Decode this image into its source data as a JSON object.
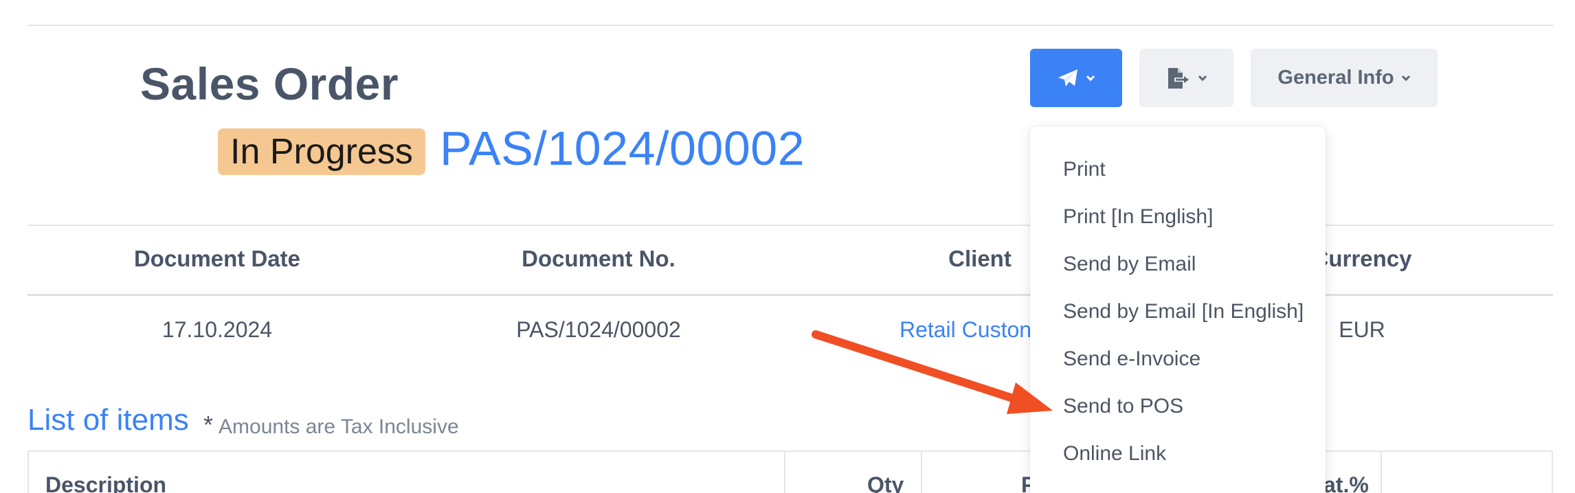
{
  "header": {
    "title": "Sales Order",
    "status": "In Progress",
    "document_number": "PAS/1024/00002"
  },
  "toolbar": {
    "send_icon": "paper-plane-icon",
    "export_icon": "file-export-icon",
    "general_info_label": "General Info"
  },
  "summary": {
    "headers": {
      "document_date": "Document Date",
      "document_no": "Document No.",
      "client": "Client",
      "currency": "Currency"
    },
    "values": {
      "document_date": "17.10.2024",
      "document_no": "PAS/1024/00002",
      "client": "Retail Custon",
      "currency": "EUR"
    }
  },
  "items_section": {
    "title": "List of items",
    "note_star": "*",
    "note": "Amounts are Tax Inclusive",
    "columns": {
      "description": "Description",
      "qty": "Qty",
      "price_partial": "P",
      "vat_partial": "at.%"
    }
  },
  "send_menu": {
    "items": [
      "Print",
      "Print [In English]",
      "Send by Email",
      "Send by Email [In English]",
      "Send e-Invoice",
      "Send to POS",
      "Online Link"
    ]
  },
  "annotation": {
    "arrow_color": "#f04e23"
  },
  "colors": {
    "accent": "#3b82f6",
    "status_badge": "#f5c892"
  }
}
